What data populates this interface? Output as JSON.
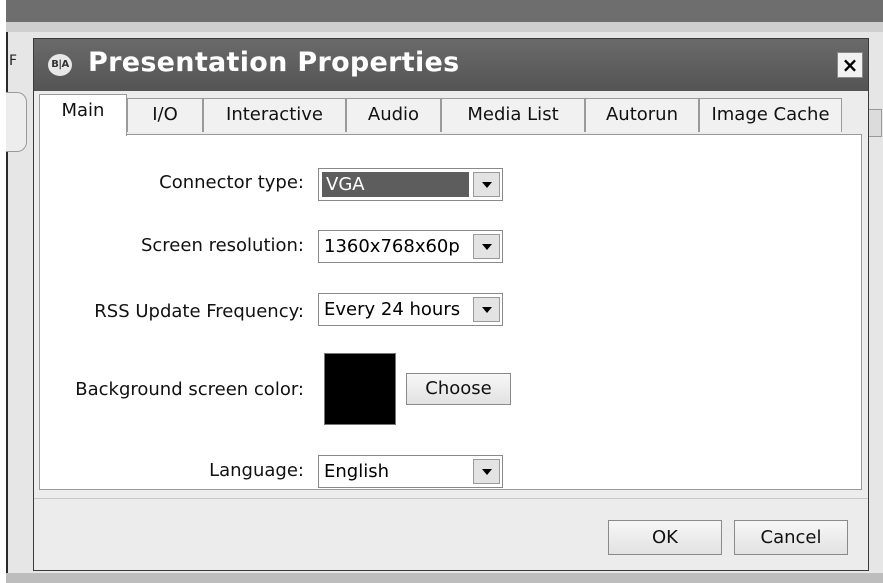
{
  "background_window": {
    "letter": "F"
  },
  "dialog": {
    "title": "Presentation Properties",
    "logo_text": "B|A",
    "close_label": "×"
  },
  "tabs": [
    {
      "label": "Main",
      "active": true
    },
    {
      "label": "I/O"
    },
    {
      "label": "Interactive"
    },
    {
      "label": "Audio"
    },
    {
      "label": "Media List"
    },
    {
      "label": "Autorun"
    },
    {
      "label": "Image Cache"
    }
  ],
  "form": {
    "connector_type": {
      "label": "Connector type:",
      "value": "VGA"
    },
    "screen_resolution": {
      "label": "Screen resolution:",
      "value": "1360x768x60p"
    },
    "rss_update_frequency": {
      "label": "RSS Update Frequency:",
      "value": "Every 24 hours"
    },
    "background_color": {
      "label": "Background screen color:",
      "color": "#000000",
      "choose_label": "Choose"
    },
    "language": {
      "label": "Language:",
      "value": "English"
    }
  },
  "footer": {
    "ok_label": "OK",
    "cancel_label": "Cancel"
  },
  "icons": {
    "dropdown": "chevron-down-icon",
    "close": "close-icon",
    "logo": "brightauthor-logo-icon"
  }
}
